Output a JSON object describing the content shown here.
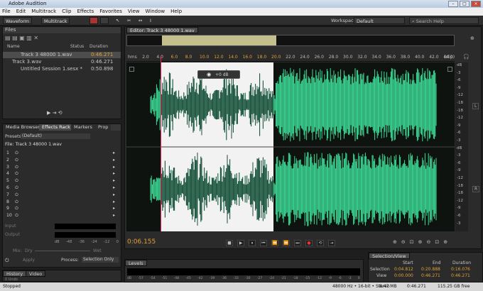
{
  "window": {
    "title": "Adobe Audition"
  },
  "menu": [
    "File",
    "Edit",
    "Multitrack",
    "Clip",
    "Effects",
    "Favorites",
    "View",
    "Window",
    "Help"
  ],
  "toolbar": {
    "waveform": "Waveform",
    "multitrack": "Multitrack",
    "workspace_label": "Workspace:",
    "workspace_value": "Default",
    "search_placeholder": "Search Help"
  },
  "files": {
    "title": "Files",
    "col_name": "Name",
    "col_status": "Status",
    "col_duration": "Duration",
    "items": [
      {
        "name": "Track 3 48000 1.wav",
        "dur": "0:46.271"
      },
      {
        "name": "Track 3.wav",
        "dur": "0:46.271"
      },
      {
        "name": "Untitled Session 1.sesx *",
        "dur": "0:50.898"
      }
    ]
  },
  "tabs": {
    "media": "Media Browser",
    "effects": "Effects Rack",
    "markers": "Markers",
    "props": "Prop"
  },
  "rack": {
    "presets_label": "Presets:",
    "preset": "(Default)",
    "file": "File: Track 3 48000 1.wav",
    "slots": [
      "1",
      "2",
      "3",
      "4",
      "5",
      "6",
      "7",
      "8",
      "9",
      "10"
    ],
    "input": "Input",
    "output": "Output",
    "mix": "Mix:",
    "dry": "Dry",
    "wet": "Wet",
    "apply": "Apply",
    "process_label": "Process:",
    "process_value": "Selection Only"
  },
  "history": {
    "tab": "History",
    "video": "Video",
    "undos": "0 Undo"
  },
  "editor": {
    "tab": "Editor: Track 3 48000 1.wav",
    "time": "0:06.155",
    "ruler": [
      "hms",
      "2.0",
      "4.0",
      "6.0",
      "8.0",
      "10.0",
      "12.0",
      "14.0",
      "16.0",
      "18.0",
      "20.0",
      "22.0",
      "24.0",
      "26.0",
      "28.0",
      "30.0",
      "32.0",
      "34.0",
      "36.0",
      "38.0",
      "40.0",
      "42.0",
      "44.0"
    ],
    "clip": "(clip)",
    "hud": "+0 dB"
  },
  "db_labels": [
    "dB",
    "-3",
    "-6",
    "-9",
    "-12",
    "-18",
    "-18",
    "-12",
    "-9",
    "-6",
    "-3",
    "dB",
    "-3",
    "-6",
    "-9",
    "-12",
    "-18",
    "-18",
    "-12",
    "-9",
    "-6",
    "-3"
  ],
  "lr": {
    "left": "L",
    "right": "R"
  },
  "levels": {
    "title": "Levels",
    "scale": [
      "dB",
      "-57",
      "-54",
      "-51",
      "-48",
      "-45",
      "-42",
      "-39",
      "-36",
      "-33",
      "-30",
      "-27",
      "-24",
      "-21",
      "-18",
      "-15",
      "-12",
      "-9",
      "-6",
      "-3",
      "0"
    ]
  },
  "selview": {
    "title": "Selection/View",
    "start": "Start",
    "end": "End",
    "duration": "Duration",
    "sel_label": "Selection",
    "view_label": "View",
    "sel": {
      "start": "0:04.812",
      "end": "0:20.888",
      "dur": "0:16.076"
    },
    "view": {
      "start": "0:00.000",
      "end": "0:46.271",
      "dur": "0:46.271"
    }
  },
  "fx_scale": [
    "dB",
    "-48",
    "-36",
    "-24",
    "-12",
    "0"
  ],
  "status": {
    "left": "Stopped",
    "info": [
      "48000 Hz • 16-bit • Stereo",
      "8.47 MB",
      "0:46.271",
      "115.25 GB free"
    ]
  },
  "colors": {
    "wave": "#3ddc97",
    "selection": "#f2f2f2",
    "time": "#e2a13a"
  }
}
